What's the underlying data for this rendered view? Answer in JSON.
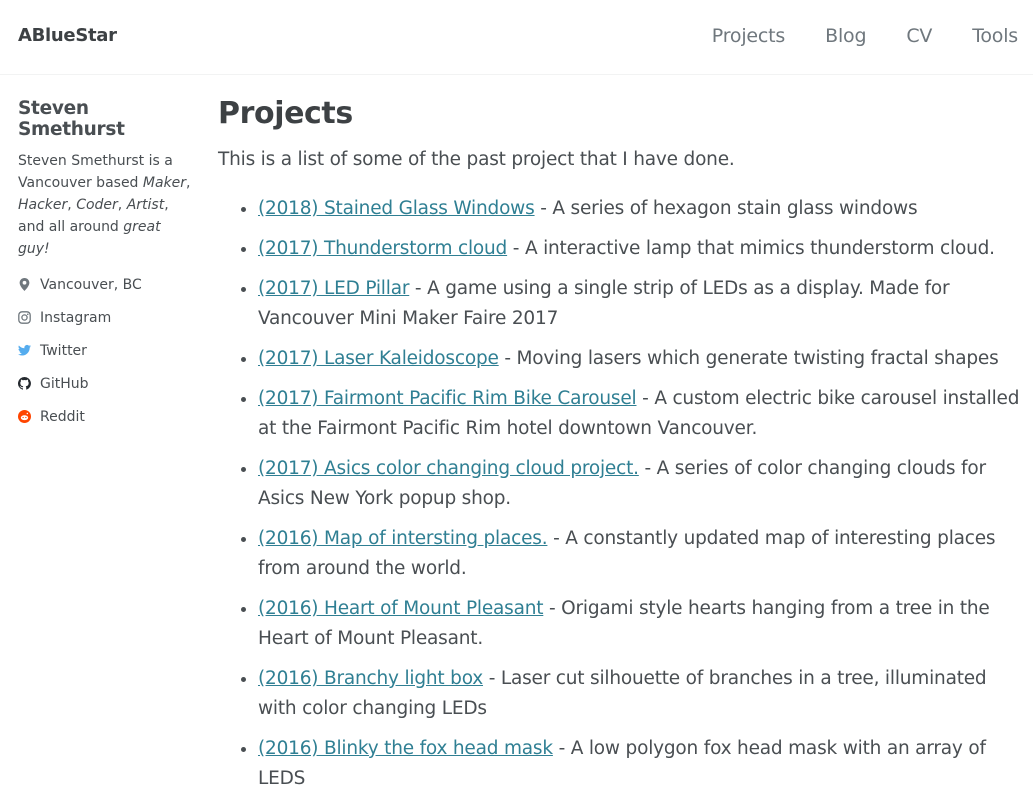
{
  "site": {
    "title": "ABlueStar",
    "nav": [
      "Projects",
      "Blog",
      "CV",
      "Tools"
    ]
  },
  "sidebar": {
    "name": "Steven Smethurst",
    "bio_start": "Steven Smethurst is a Vancouver based ",
    "bio_maker": "Maker",
    "bio_sep1": ", ",
    "bio_hacker": "Hacker",
    "bio_sep2": ", ",
    "bio_coder": "Coder",
    "bio_sep3": ", ",
    "bio_artist": "Artist",
    "bio_and": ", and all around ",
    "bio_great": "great guy!",
    "links": [
      {
        "label": "Vancouver, BC",
        "icon": "map-marker-icon",
        "color": "#6f777d"
      },
      {
        "label": "Instagram",
        "icon": "instagram-icon",
        "color": "#6f777d"
      },
      {
        "label": "Twitter",
        "icon": "twitter-icon",
        "color": "#55acee"
      },
      {
        "label": "GitHub",
        "icon": "github-icon",
        "color": "#24292e"
      },
      {
        "label": "Reddit",
        "icon": "reddit-icon",
        "color": "#ff4500"
      }
    ]
  },
  "main": {
    "title": "Projects",
    "intro": "This is a list of some of the past project that I have done.",
    "projects": [
      {
        "link": "(2018) Stained Glass Windows",
        "desc": " - A series of hexagon stain glass windows"
      },
      {
        "link": "(2017) Thunderstorm cloud",
        "desc": " - A interactive lamp that mimics thunderstorm cloud."
      },
      {
        "link": "(2017) LED Pillar",
        "desc": " - A game using a single strip of LEDs as a display. Made for Vancouver Mini Maker Faire 2017"
      },
      {
        "link": "(2017) Laser Kaleidoscope",
        "desc": " - Moving lasers which generate twisting fractal shapes"
      },
      {
        "link": "(2017) Fairmont Pacific Rim Bike Carousel",
        "desc": " - A custom electric bike carousel installed at the Fairmont Pacific Rim hotel downtown Vancouver."
      },
      {
        "link": "(2017) Asics color changing cloud project.",
        "desc": " - A series of color changing clouds for Asics New York popup shop."
      },
      {
        "link": "(2016) Map of intersting places.",
        "desc": " - A constantly updated map of interesting places from around the world."
      },
      {
        "link": "(2016) Heart of Mount Pleasant",
        "desc": " - Origami style hearts hanging from a tree in the Heart of Mount Pleasant."
      },
      {
        "link": "(2016) Branchy light box",
        "desc": " - Laser cut silhouette of branches in a tree, illuminated with color changing LEDs"
      },
      {
        "link": "(2016) Blinky the fox head mask",
        "desc": " - A low polygon fox head mask with an array of LEDS"
      }
    ]
  },
  "colors": {
    "link": "#2f7f93",
    "text": "#494e52",
    "nav": "#6f777d"
  }
}
